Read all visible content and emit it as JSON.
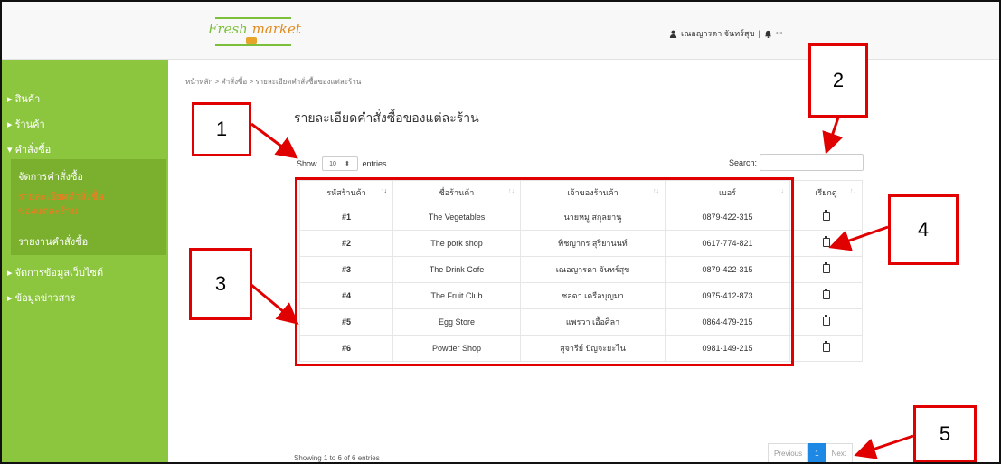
{
  "header": {
    "logo_text_a": "Fresh ",
    "logo_text_b": "market",
    "user_name": "เณอญารดา จันทร์สุข",
    "separator": "|",
    "more": "•••"
  },
  "sidebar": {
    "items": [
      {
        "label": "▸ สินค้า"
      },
      {
        "label": "▸ ร้านค้า"
      },
      {
        "label": "▾ คำสั่งซื้อ"
      },
      {
        "label": "▸ จัดการข้อมูลเว็บไซต์"
      },
      {
        "label": "▸ ข้อมูลข่าวสาร"
      }
    ],
    "submenu": [
      {
        "label": "จัดการคำสั่งซื้อ"
      },
      {
        "label": "รายละเอียดคำสั่งซื้อของแต่ละร้าน"
      },
      {
        "label": "รายงานคำสั่งซื้อ"
      }
    ]
  },
  "breadcrumb": "หน้าหลัก > คำสั่งซื้อ > รายละเอียดคำสั่งซื้อของแต่ละร้าน",
  "page_title": "รายละเอียดคำสั่งซื้อของแต่ละร้าน",
  "controls": {
    "show_label": "Show",
    "entries_value": "10",
    "entries_label": "entries",
    "search_label": "Search:",
    "search_value": ""
  },
  "table": {
    "columns": [
      "รหัสร้านค้า",
      "ชื่อร้านค้า",
      "เจ้าของร้านค้า",
      "เบอร์",
      "เรียกดู"
    ],
    "rows": [
      {
        "code": "#1",
        "shop": "The Vegetables",
        "owner": "นายหมู สกุลยานู",
        "phone": "0879-422-315"
      },
      {
        "code": "#2",
        "shop": "The pork shop",
        "owner": "พิชญากร สุริยานนท์",
        "phone": "0617-774-821"
      },
      {
        "code": "#3",
        "shop": "The Drink Cofe",
        "owner": "เณอญารดา จันทร์สุข",
        "phone": "0879-422-315"
      },
      {
        "code": "#4",
        "shop": "The Fruit Club",
        "owner": "ชลดา เครือบุญมา",
        "phone": "0975-412-873"
      },
      {
        "code": "#5",
        "shop": "Egg Store",
        "owner": "แพรวา เอื้อศิลา",
        "phone": "0864-479-215"
      },
      {
        "code": "#6",
        "shop": "Powder Shop",
        "owner": "สุจารีย์ ปัญจะยะไน",
        "phone": "0981-149-215"
      }
    ]
  },
  "footer": {
    "showing_text": "Showing 1 to 6 of 6 entries",
    "previous": "Previous",
    "current_page": "1",
    "next": "Next"
  },
  "annotations": {
    "labels": [
      "1",
      "2",
      "3",
      "4",
      "5"
    ],
    "color": "#e00000"
  }
}
